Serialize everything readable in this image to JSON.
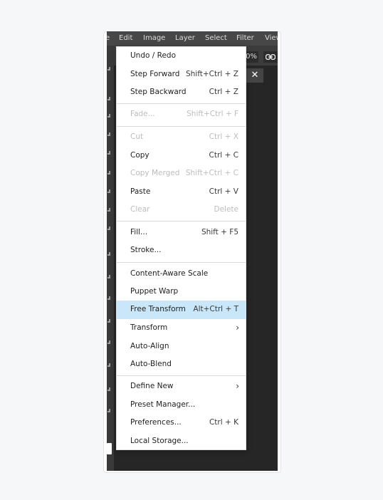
{
  "menubar": {
    "items": [
      "e",
      "Edit",
      "Image",
      "Layer",
      "Select",
      "Filter",
      "View"
    ]
  },
  "toolbar": {
    "zoom_text": "0%",
    "close_symbol": "✕"
  },
  "edit_menu": {
    "items": [
      {
        "label": "Undo / Redo",
        "shortcut": "",
        "disabled": false
      },
      {
        "label": "Step Forward",
        "shortcut": "Shift+Ctrl + Z",
        "disabled": false
      },
      {
        "label": "Step Backward",
        "shortcut": "Ctrl + Z",
        "disabled": false
      },
      {
        "label": "Fade...",
        "shortcut": "Shift+Ctrl + F",
        "disabled": true
      },
      {
        "label": "Cut",
        "shortcut": "Ctrl + X",
        "disabled": true
      },
      {
        "label": "Copy",
        "shortcut": "Ctrl + C",
        "disabled": false
      },
      {
        "label": "Copy Merged",
        "shortcut": "Shift+Ctrl + C",
        "disabled": true
      },
      {
        "label": "Paste",
        "shortcut": "Ctrl + V",
        "disabled": false
      },
      {
        "label": "Clear",
        "shortcut": "Delete",
        "disabled": true
      },
      {
        "label": "Fill...",
        "shortcut": "Shift + F5",
        "disabled": false
      },
      {
        "label": "Stroke...",
        "shortcut": "",
        "disabled": false
      },
      {
        "label": "Content-Aware Scale",
        "shortcut": "",
        "disabled": false
      },
      {
        "label": "Puppet Warp",
        "shortcut": "",
        "disabled": false
      },
      {
        "label": "Free Transform",
        "shortcut": "Alt+Ctrl + T",
        "disabled": false,
        "highlighted": true
      },
      {
        "label": "Transform",
        "shortcut": "",
        "disabled": false,
        "submenu": true
      },
      {
        "label": "Auto-Align",
        "shortcut": "",
        "disabled": false
      },
      {
        "label": "Auto-Blend",
        "shortcut": "",
        "disabled": false
      },
      {
        "label": "Define New",
        "shortcut": "",
        "disabled": false,
        "submenu": true
      },
      {
        "label": "Preset Manager...",
        "shortcut": "",
        "disabled": false
      },
      {
        "label": "Preferences...",
        "shortcut": "Ctrl + K",
        "disabled": false
      },
      {
        "label": "Local Storage...",
        "shortcut": "",
        "disabled": false
      }
    ],
    "highlight_color": "#c9e7f8"
  }
}
